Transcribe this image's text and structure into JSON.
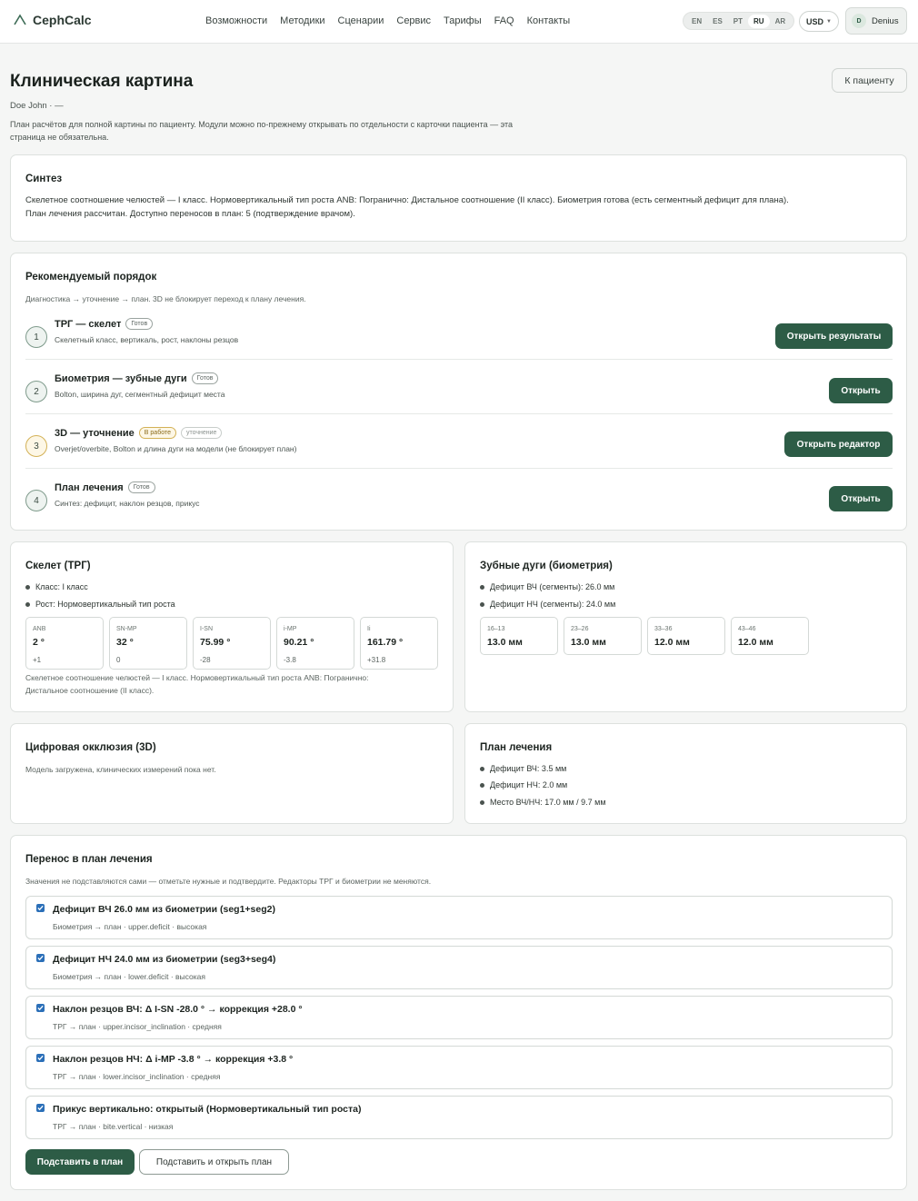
{
  "header": {
    "brand": "CephCalc",
    "nav": [
      "Возможности",
      "Методики",
      "Сценарии",
      "Сервис",
      "Тарифы",
      "FAQ",
      "Контакты"
    ],
    "languages": [
      "EN",
      "ES",
      "PT",
      "RU",
      "AR"
    ],
    "active_language": "RU",
    "currency": "USD",
    "user_initial": "D",
    "user_name": "Denius"
  },
  "page": {
    "title": "Клиническая картина",
    "patient": "Doe John · —",
    "intro": "План расчётов для полной картины по пациенту. Модули можно по-прежнему открывать по отдельности с карточки пациента — эта страница не обязательна.",
    "back_button": "К пациенту"
  },
  "synthesis": {
    "title": "Синтез",
    "line1": "Скелетное соотношение челюстей — I класс. Нормовертикальный тип роста ANB: Погранично: Дистальное соотношение (II класс). Биометрия готова (есть сегментный дефицит для плана).",
    "line2": "План лечения рассчитан. Доступно переносов в план: 5 (подтверждение врачом)."
  },
  "order": {
    "title": "Рекомендуемый порядок",
    "subtitle": "Диагностика → уточнение → план. 3D не блокирует переход к плану лечения.",
    "steps": [
      {
        "num": "1",
        "title": "ТРГ — скелет",
        "badge": "Готов",
        "sub": "Скелетный класс, вертикаль, рост, наклоны резцов",
        "button": "Открыть результаты"
      },
      {
        "num": "2",
        "title": "Биометрия — зубные дуги",
        "badge": "Готов",
        "sub": "Bolton, ширина дуг, сегментный дефицит места",
        "button": "Открыть"
      },
      {
        "num": "3",
        "title": "3D — уточнение",
        "badge": "В работе",
        "badge2": "уточнение",
        "sub": "Overjet/overbite, Bolton и длина дуги на модели (не блокирует план)",
        "button": "Открыть редактор"
      },
      {
        "num": "4",
        "title": "План лечения",
        "badge": "Готов",
        "sub": "Синтез: дефицит, наклон резцов, прикус",
        "button": "Открыть"
      }
    ]
  },
  "skeleton": {
    "title": "Скелет (ТРГ)",
    "bullets": [
      "Класс: I класс",
      "Рост: Нормовертикальный тип роста"
    ],
    "metrics": [
      {
        "label": "ANB",
        "value": "2 °",
        "delta": "+1"
      },
      {
        "label": "SN-MP",
        "value": "32 °",
        "delta": "0"
      },
      {
        "label": "I-SN",
        "value": "75.99 °",
        "delta": "-28"
      },
      {
        "label": "i-MP",
        "value": "90.21 °",
        "delta": "-3.8"
      },
      {
        "label": "Ii",
        "value": "161.79 °",
        "delta": "+31.8"
      }
    ],
    "summary1": "Скелетное соотношение челюстей — I класс. Нормовертикальный тип роста ANB: Погранично:",
    "summary2": "Дистальное соотношение (II класс)."
  },
  "arches": {
    "title": "Зубные дуги (биометрия)",
    "bullets": [
      "Дефицит ВЧ (сегменты): 26.0 мм",
      "Дефицит НЧ (сегменты): 24.0 мм"
    ],
    "metrics": [
      {
        "label": "16–13",
        "value": "13.0 мм"
      },
      {
        "label": "23–26",
        "value": "13.0 мм"
      },
      {
        "label": "33–36",
        "value": "12.0 мм"
      },
      {
        "label": "43–46",
        "value": "12.0 мм"
      }
    ]
  },
  "occlusion": {
    "title": "Цифровая окклюзия (3D)",
    "text": "Модель загружена, клинических измерений пока нет."
  },
  "plan": {
    "title": "План лечения",
    "bullets": [
      "Дефицит ВЧ: 3.5 мм",
      "Дефицит НЧ: 2.0 мм",
      "Место ВЧ/НЧ: 17.0 мм / 9.7 мм"
    ]
  },
  "transfer": {
    "title": "Перенос в план лечения",
    "subtitle": "Значения не подставляются сами — отметьте нужные и подтвердите. Редакторы ТРГ и биометрии не меняются.",
    "items": [
      {
        "title": "Дефицит ВЧ 26.0 мм из биометрии (seg1+seg2)",
        "sub": "Биометрия → план · upper.deficit · высокая"
      },
      {
        "title": "Дефицит НЧ 24.0 мм из биометрии (seg3+seg4)",
        "sub": "Биометрия → план · lower.deficit · высокая"
      },
      {
        "title": "Наклон резцов ВЧ: Δ I-SN -28.0 ° → коррекция +28.0 °",
        "sub": "ТРГ → план · upper.incisor_inclination · средняя"
      },
      {
        "title": "Наклон резцов НЧ: Δ i-MP -3.8 ° → коррекция +3.8 °",
        "sub": "ТРГ → план · lower.incisor_inclination · средняя"
      },
      {
        "title": "Прикус вертикально: открытый (Нормовертикальный тип роста)",
        "sub": "ТРГ → план · bite.vertical · низкая"
      }
    ],
    "apply_button": "Подставить в план",
    "apply_open_button": "Подставить и открыть план"
  }
}
